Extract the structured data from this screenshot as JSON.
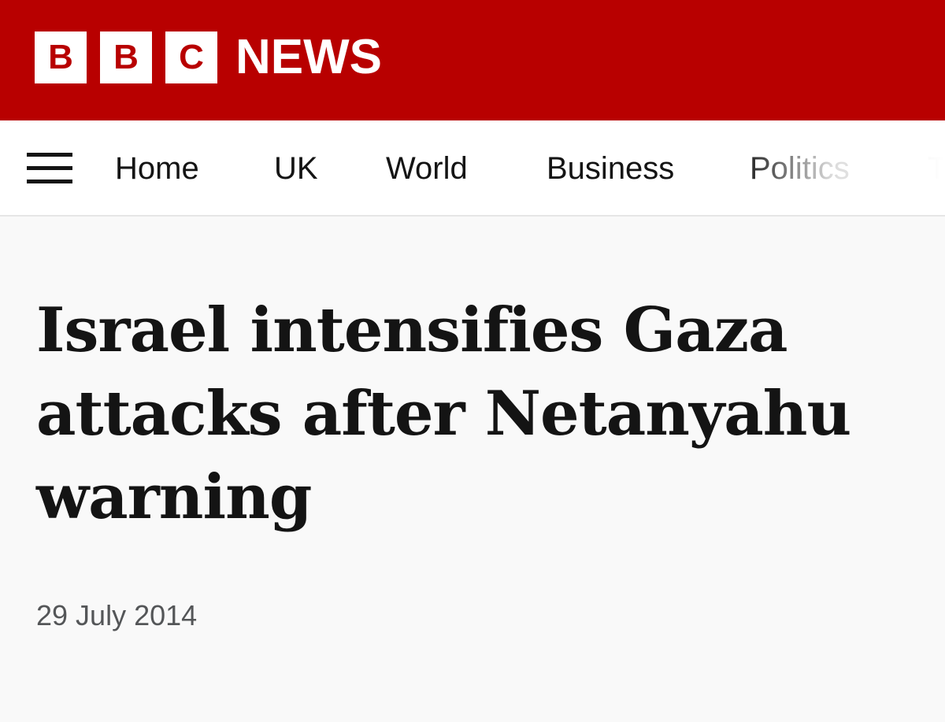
{
  "brand": {
    "logo_letters": [
      "B",
      "B",
      "C"
    ],
    "logo_word": "NEWS",
    "masthead_color": "#b80000"
  },
  "nav": {
    "menu_icon": "hamburger-menu-icon",
    "items": [
      {
        "label": "Home"
      },
      {
        "label": "UK"
      },
      {
        "label": "World"
      },
      {
        "label": "Business"
      },
      {
        "label": "Politics"
      },
      {
        "label": "T"
      }
    ]
  },
  "article": {
    "headline": "Israel intensifies Gaza attacks after Netanyahu warning",
    "date": "29 July 2014"
  }
}
